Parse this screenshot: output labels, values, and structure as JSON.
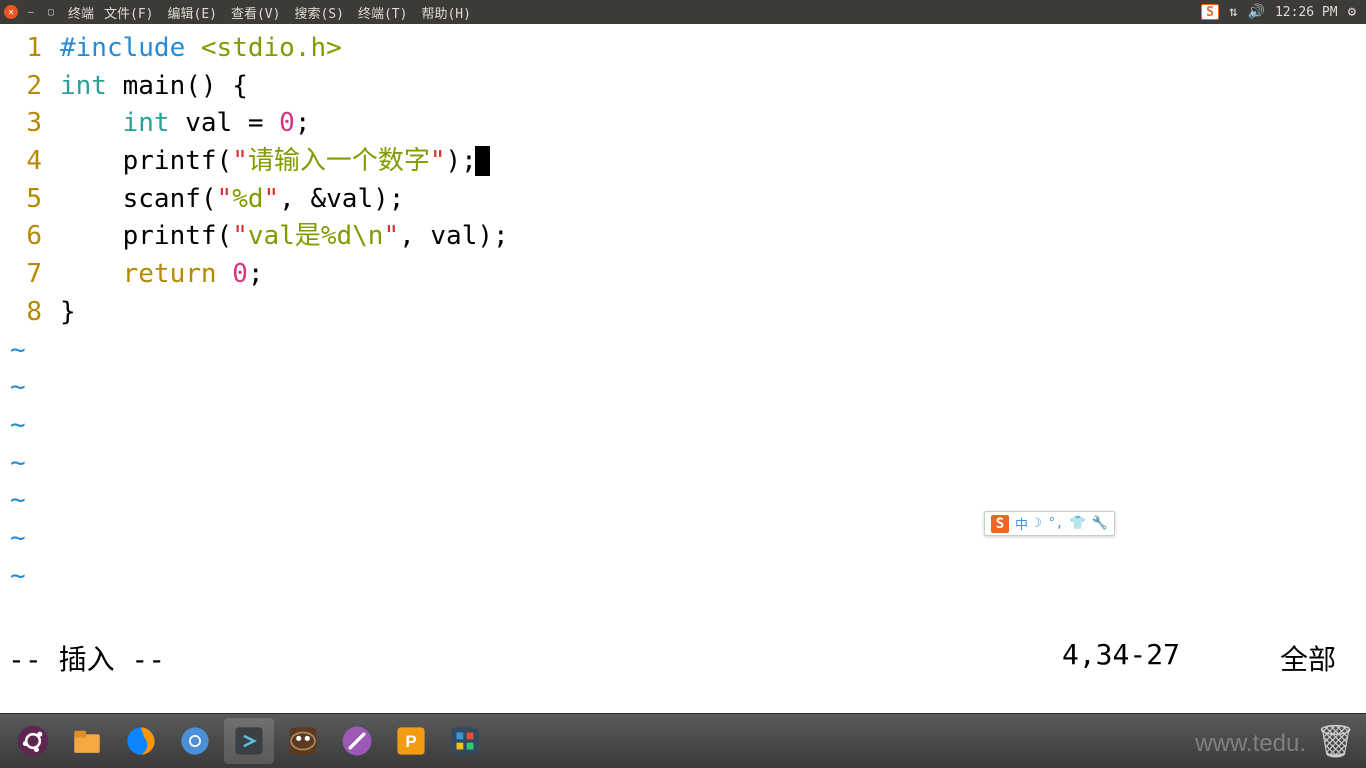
{
  "menubar": {
    "app_label": "终端",
    "items": [
      "文件(F)",
      "编辑(E)",
      "查看(V)",
      "搜索(S)",
      "终端(T)",
      "帮助(H)"
    ],
    "clock": "12:26 PM"
  },
  "editor": {
    "lines": [
      {
        "n": "1",
        "tokens": [
          [
            "preproc",
            "#include "
          ],
          [
            "angled",
            "<stdio.h>"
          ]
        ]
      },
      {
        "n": "2",
        "tokens": [
          [
            "kw-type",
            "int"
          ],
          [
            "",
            " main() {"
          ]
        ]
      },
      {
        "n": "3",
        "tokens": [
          [
            "",
            "    "
          ],
          [
            "kw-type",
            "int"
          ],
          [
            "",
            " val = "
          ],
          [
            "num",
            "0"
          ],
          [
            "",
            ";"
          ]
        ]
      },
      {
        "n": "4",
        "tokens": [
          [
            "",
            "    printf("
          ],
          [
            "str",
            "\""
          ],
          [
            "str-green",
            "请输入一个数字"
          ],
          [
            "str",
            "\""
          ],
          [
            "",
            ");"
          ]
        ],
        "cursor": true
      },
      {
        "n": "5",
        "tokens": [
          [
            "",
            "    scanf("
          ],
          [
            "str",
            "\""
          ],
          [
            "str-green",
            "%d"
          ],
          [
            "str",
            "\""
          ],
          [
            "",
            ", &val);"
          ]
        ]
      },
      {
        "n": "6",
        "tokens": [
          [
            "",
            "    printf("
          ],
          [
            "str",
            "\""
          ],
          [
            "str-green",
            "val是"
          ],
          [
            "str-green",
            "%d\\n"
          ],
          [
            "str",
            "\""
          ],
          [
            "",
            ", val);"
          ]
        ]
      },
      {
        "n": "7",
        "tokens": [
          [
            "",
            "    "
          ],
          [
            "kw",
            "return"
          ],
          [
            "",
            " "
          ],
          [
            "num",
            "0"
          ],
          [
            "",
            ";"
          ]
        ]
      },
      {
        "n": "8",
        "tokens": [
          [
            "",
            "}"
          ]
        ]
      }
    ],
    "tilde_count": 7
  },
  "status": {
    "mode": "-- 插入 --",
    "position": "4,34-27",
    "scroll": "全部"
  },
  "ime": {
    "mode": "中"
  },
  "watermark": "www.tedu."
}
